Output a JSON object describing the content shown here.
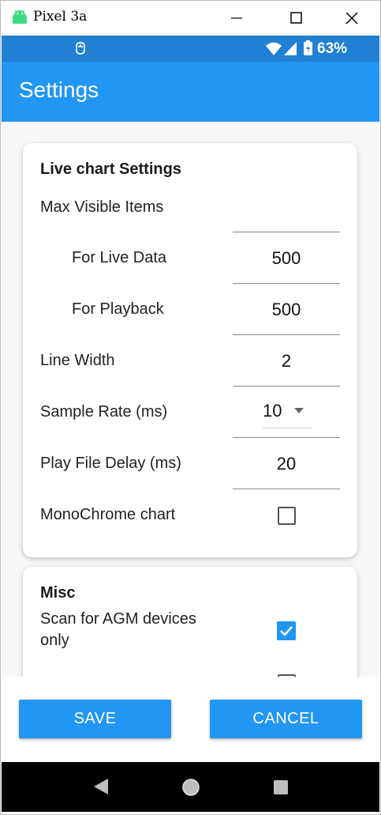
{
  "window": {
    "title": "Pixel 3a",
    "minimize_icon": "minimize-icon",
    "maximize_icon": "maximize-icon",
    "close_icon": "close-icon"
  },
  "status_bar": {
    "battery_text": "63%",
    "icons": [
      "notification-icon",
      "wifi-icon",
      "signal-icon",
      "battery-icon"
    ]
  },
  "app_bar": {
    "title": "Settings"
  },
  "live_chart": {
    "section_title": "Live chart Settings",
    "max_visible_label": "Max Visible Items",
    "for_live_data_label": "For Live Data",
    "for_live_data_value": "500",
    "for_playback_label": "For Playback",
    "for_playback_value": "500",
    "line_width_label": "Line Width",
    "line_width_value": "2",
    "sample_rate_label": "Sample Rate (ms)",
    "sample_rate_value": "10",
    "play_file_delay_label": "Play File Delay (ms)",
    "play_file_delay_value": "20",
    "monochrome_label": "MonoChrome chart",
    "monochrome_checked": false
  },
  "misc": {
    "section_title": "Misc",
    "scan_agm_label_line1": "Scan for AGM devices",
    "scan_agm_label_line2": "only",
    "scan_agm_checked": true,
    "next_item_checked": false
  },
  "buttons": {
    "save": "SAVE",
    "cancel": "CANCEL"
  },
  "colors": {
    "status_bar": "#1f80d4",
    "app_bar": "#2196f3",
    "button": "#2196f3",
    "checkbox_checked": "#2196f3"
  }
}
